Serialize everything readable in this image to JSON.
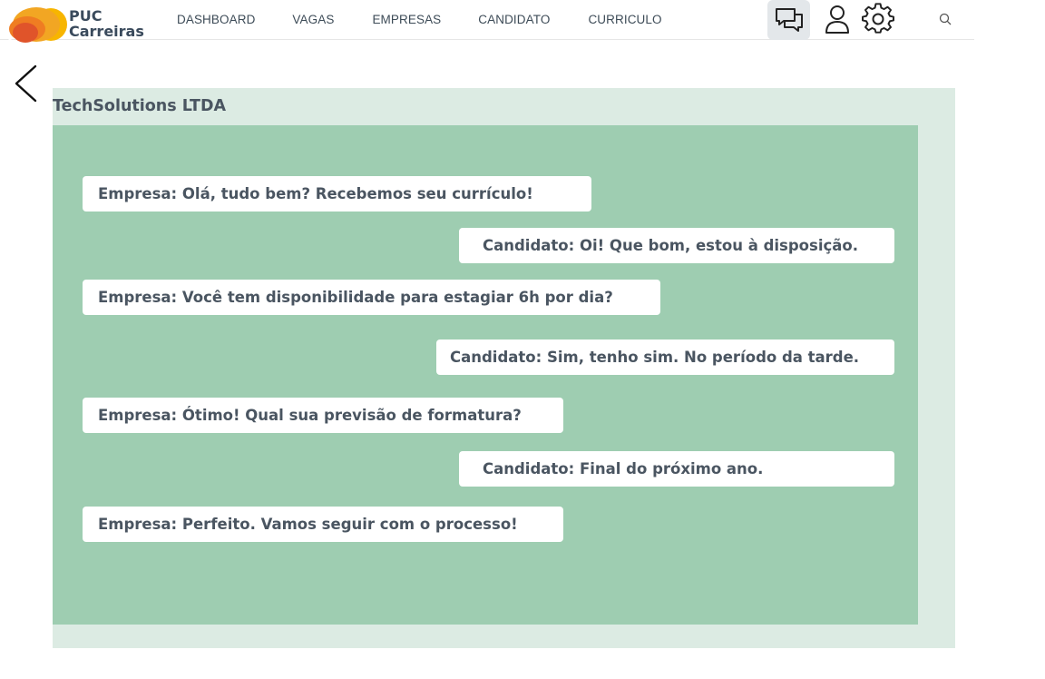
{
  "brand": {
    "line1": "PUC",
    "line2": "Carreiras",
    "colors": [
      "#f2a623",
      "#f7b500",
      "#ef7d22",
      "#e0542a"
    ]
  },
  "nav": {
    "items": [
      {
        "label": "DASHBOARD"
      },
      {
        "label": "VAGAS"
      },
      {
        "label": "EMPRESAS"
      },
      {
        "label": "CANDIDATO"
      },
      {
        "label": "CURRICULO"
      }
    ]
  },
  "header_icons": [
    "chat-icon",
    "user-icon",
    "gear-icon",
    "search-icon"
  ],
  "conversation": {
    "company": "TechSolutions LTDA",
    "messages": [
      {
        "side": "left",
        "text": "Empresa: Olá, tudo bem? Recebemos seu currículo!"
      },
      {
        "side": "right",
        "text": "Candidato: Oi! Que bom, estou à disposição."
      },
      {
        "side": "left",
        "text": "Empresa: Você tem disponibilidade para estagiar 6h por dia?"
      },
      {
        "side": "right",
        "text": "Candidato: Sim, tenho sim. No período da tarde."
      },
      {
        "side": "left",
        "text": "Empresa: Ótimo! Qual sua previsão de formatura?"
      },
      {
        "side": "right",
        "text": "Candidato: Final do próximo ano."
      },
      {
        "side": "left",
        "text": "Empresa: Perfeito. Vamos seguir com o processo!"
      }
    ]
  },
  "colors": {
    "panel_bg": "#dcebe3",
    "chat_bg": "#9ecdb1",
    "bubble_bg": "#ffffff",
    "text": "#4a5561"
  }
}
